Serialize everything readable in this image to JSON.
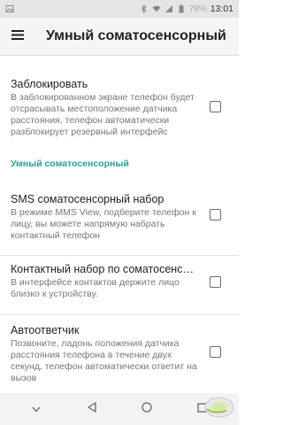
{
  "status_bar": {
    "battery": "79%",
    "time": "13:01"
  },
  "app_bar": {
    "title": "Умный соматосенсорный"
  },
  "prefs": [
    {
      "title": "Заблокировать",
      "summary": "В заблокированном экране телефон будет отсрасывать местоположение датчика расстояния, телефон автоматически разблокирует резервный интерфейс",
      "checked": false
    },
    {
      "title": "SMS соматосенсорный набор",
      "summary": "В режиме MMS View, подберите телефон к лицу, вы можете напрямую набрать контактный телефон",
      "checked": false
    },
    {
      "title": "Контактный набор по соматосенсор..",
      "summary": "В интерфейсе контактов держите лицо близко к устройству.",
      "checked": false
    },
    {
      "title": "Автоответчик",
      "summary": "Позвоните, ладонь положения датчика расстояния телефона в течение двух секунд, телефон автоматически ответит на вызов",
      "checked": false
    }
  ],
  "category": {
    "label": "Умный соматосенсорный"
  },
  "colors": {
    "accent": "#2a9d8f"
  }
}
